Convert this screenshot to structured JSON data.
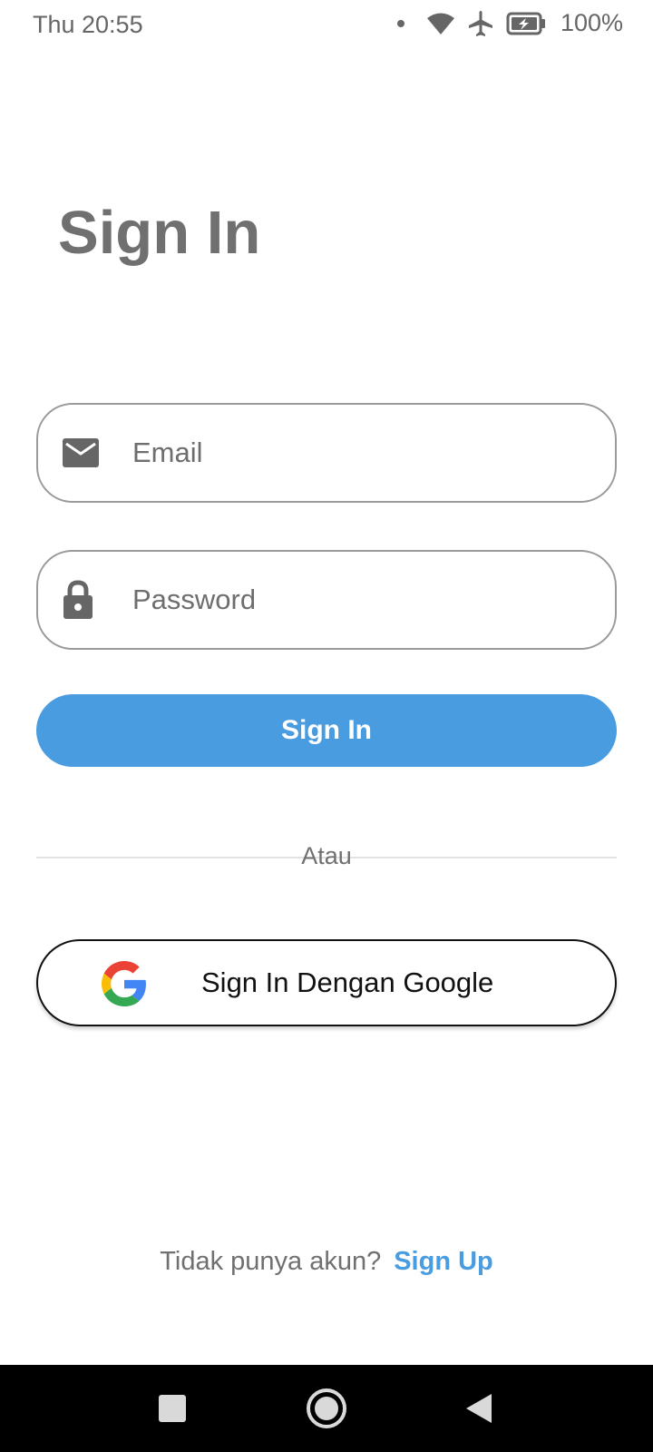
{
  "status_bar": {
    "time": "Thu 20:55",
    "battery": "100%",
    "icons": [
      "notification-dot-icon",
      "wifi-icon",
      "airplane-mode-icon",
      "battery-charging-icon"
    ]
  },
  "page": {
    "title": "Sign In"
  },
  "form": {
    "email_placeholder": "Email",
    "password_placeholder": "Password",
    "email_icon": "mail-icon",
    "password_icon": "lock-icon",
    "submit_label": "Sign In"
  },
  "divider": {
    "label": "Atau"
  },
  "google": {
    "label": "Sign In Dengan Google",
    "icon": "google-icon"
  },
  "signup": {
    "prompt": "Tidak punya akun?",
    "link": "Sign Up"
  },
  "nav_bar": {
    "buttons": [
      "recents-icon",
      "home-icon",
      "back-icon"
    ]
  },
  "colors": {
    "accent": "#4a9ce0",
    "title": "#707070",
    "field_border": "#9a9a9a"
  }
}
